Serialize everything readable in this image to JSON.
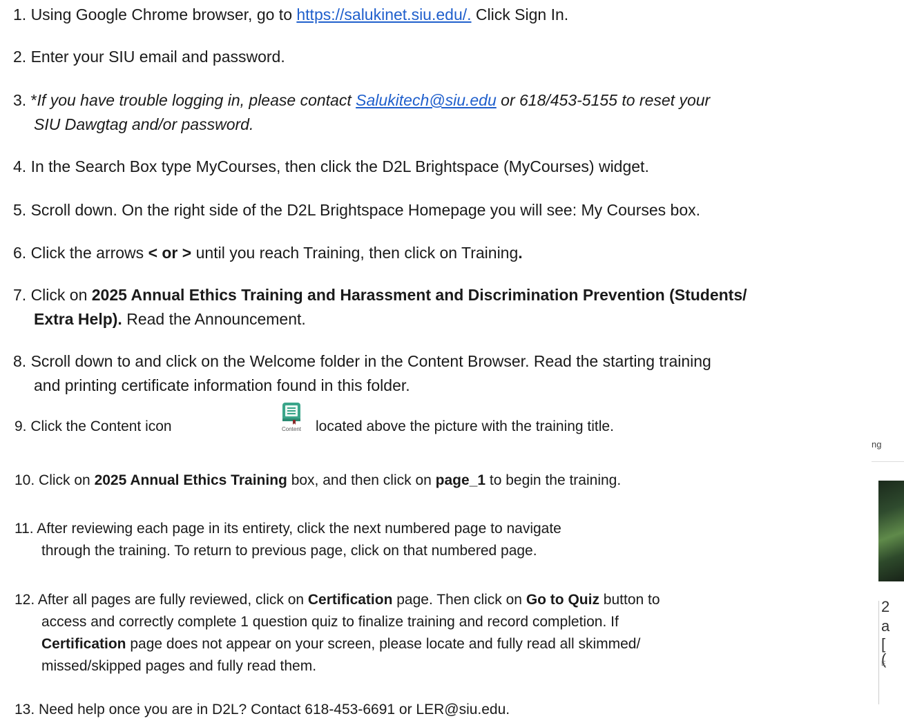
{
  "steps": {
    "s1": {
      "a": "1. Using Google Chrome browser, go to ",
      "link": "https://salukinet.siu.edu/.",
      "b": " Click Sign In."
    },
    "s2": {
      "text": "2. Enter your SIU email and password."
    },
    "s3": {
      "a": "3. *",
      "i1": "If you have trouble logging in, please contact ",
      "link": "Salukitech@siu.edu",
      "i2": " or 618/453-5155 to reset your",
      "line2": "SIU Dawgtag and/or password."
    },
    "s4": {
      "text": "4. In the Search Box type MyCourses, then click the D2L Brightspace (MyCourses) widget."
    },
    "s5": {
      "text": "5. Scroll down. On the right side of the D2L Brightspace Homepage you will see: My Courses box."
    },
    "s6": {
      "a": "6. Click the arrows ",
      "bold": "< or >",
      "b": " until you reach Training, then click on Training",
      "bold2": "."
    },
    "s7": {
      "a": "7. Click on ",
      "bold": "2025 Annual Ethics Training and Harassment and Discrimination Prevention (Students/",
      "bold_line2": "Extra Help).",
      "b": "  Read the Announcement."
    },
    "s8": {
      "line1": "8. Scroll down to and click on the Welcome folder in the Content Browser. Read the starting training",
      "line2": "and printing certificate information found in this folder."
    },
    "s9": {
      "a": "9. Click the Content icon",
      "icon_caption": "Content",
      "icon": "content-book-icon",
      "b": "located above the picture with the training title."
    },
    "s10": {
      "a": "10. Click on ",
      "bold": "2025 Annual Ethics Training",
      "b": " box, and then click on ",
      "bold2": "page_1",
      "c": " to begin the training."
    },
    "s11": {
      "line1": "11. After reviewing each page in its entirety, click the next numbered page to navigate",
      "line2": "through the training. To return to previous page, click on that numbered page."
    },
    "s12": {
      "a": "12. After all pages are fully reviewed, click on ",
      "bold": "Certification",
      "b": " page. Then click on ",
      "bold2": "Go to Quiz",
      "c": " button to",
      "line2": "access and correctly complete 1 question quiz to finalize training and record completion. If",
      "line3_bold": "Certification",
      "line3": " page does not appear on your screen, please locate and fully read all skimmed/",
      "line4": "missed/skipped pages and fully read them."
    },
    "s13": {
      "text": "13. Need help once you are in D2L? Contact 618-453-6691 or LER@siu.edu."
    }
  },
  "edge_fragment": {
    "top_text": "ng",
    "chars": [
      "2",
      "a",
      "[",
      "("
    ],
    "small": "E"
  },
  "colors": {
    "link": "#1f5fcc",
    "icon_green": "#3aa58a",
    "text": "#1a1a1a"
  }
}
